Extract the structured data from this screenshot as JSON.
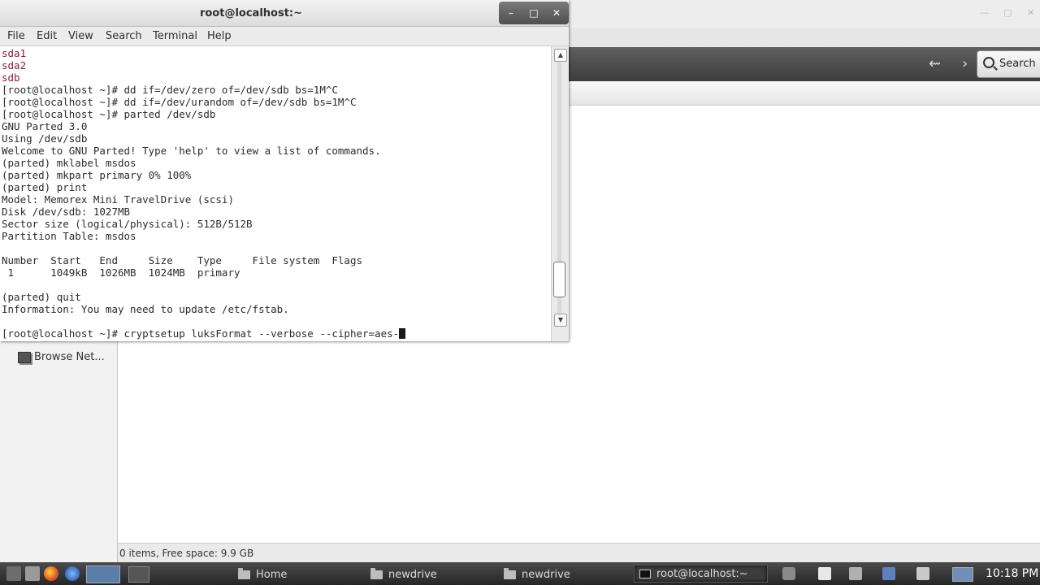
{
  "file_manager": {
    "search_label": "Search",
    "back_glyph": "⇜",
    "forward_glyph": "›",
    "sidebar": {
      "items": [
        {
          "label": "Browse Net...",
          "icon": "network-icon"
        }
      ]
    },
    "status": "0 items, Free space: 9.9 GB"
  },
  "terminal": {
    "title": "root@localhost:~",
    "menu": [
      "File",
      "Edit",
      "View",
      "Search",
      "Terminal",
      "Help"
    ],
    "lines": [
      {
        "text": "sda1",
        "style": "dev"
      },
      {
        "text": "sda2",
        "style": "dev"
      },
      {
        "text": "sdb",
        "style": "dev"
      },
      {
        "text": "[root@localhost ~]# dd if=/dev/zero of=/dev/sdb bs=1M^C",
        "style": ""
      },
      {
        "text": "[root@localhost ~]# dd if=/dev/urandom of=/dev/sdb bs=1M^C",
        "style": ""
      },
      {
        "text": "[root@localhost ~]# parted /dev/sdb",
        "style": ""
      },
      {
        "text": "GNU Parted 3.0",
        "style": ""
      },
      {
        "text": "Using /dev/sdb",
        "style": ""
      },
      {
        "text": "Welcome to GNU Parted! Type 'help' to view a list of commands.",
        "style": ""
      },
      {
        "text": "(parted) mklabel msdos",
        "style": ""
      },
      {
        "text": "(parted) mkpart primary 0% 100%",
        "style": ""
      },
      {
        "text": "(parted) print",
        "style": ""
      },
      {
        "text": "Model: Memorex Mini TravelDrive (scsi)",
        "style": ""
      },
      {
        "text": "Disk /dev/sdb: 1027MB",
        "style": ""
      },
      {
        "text": "Sector size (logical/physical): 512B/512B",
        "style": ""
      },
      {
        "text": "Partition Table: msdos",
        "style": ""
      },
      {
        "text": "",
        "style": ""
      },
      {
        "text": "Number  Start   End     Size    Type     File system  Flags",
        "style": ""
      },
      {
        "text": " 1      1049kB  1026MB  1024MB  primary",
        "style": ""
      },
      {
        "text": "",
        "style": ""
      },
      {
        "text": "(parted) quit",
        "style": ""
      },
      {
        "text": "Information: You may need to update /etc/fstab.",
        "style": ""
      },
      {
        "text": "",
        "style": ""
      },
      {
        "text": "[root@localhost ~]# cryptsetup luksFormat --verbose --cipher=aes-",
        "style": "prompt"
      }
    ],
    "scroll_position": 0.93
  },
  "taskbar": {
    "tasks": [
      {
        "label": "Home",
        "icon": "folder-icon"
      },
      {
        "label": "newdrive",
        "icon": "folder-icon"
      },
      {
        "label": "newdrive",
        "icon": "folder-icon"
      },
      {
        "label": "root@localhost:~",
        "icon": "terminal-icon"
      }
    ],
    "clock": "10:18 PM"
  }
}
